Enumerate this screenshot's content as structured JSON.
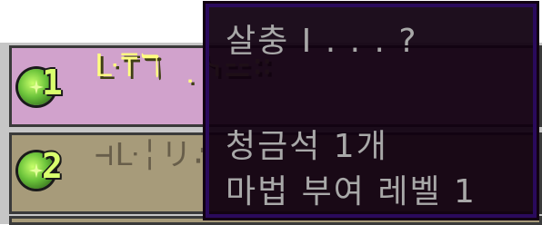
{
  "options": [
    {
      "cost": "1",
      "galactic": "ᒷ⍑ℸ ̣ ᓭ⚍∷",
      "level": ""
    },
    {
      "cost": "2",
      "galactic": "⊣ᒷ╎リ∴",
      "level": ""
    },
    {
      "cost": "",
      "galactic": "",
      "level": ""
    }
  ],
  "tooltip": {
    "title": "살충 I . . . ?",
    "cost_line": "청금석 1개",
    "level_line": "마법 부여 레벨 1"
  },
  "colors": {
    "tooltip_bg": "#100010",
    "tooltip_border": "#2a0a5c",
    "tooltip_text": "#a8a8a8",
    "option_highlight": "#d1a2cc",
    "option_default": "#a79b7a",
    "galactic_active": "#ffff80",
    "galactic_inactive": "#685e4a",
    "cost_badge": "#d9ff6e"
  },
  "icons": {
    "cost_orb": "experience-orb-icon"
  }
}
